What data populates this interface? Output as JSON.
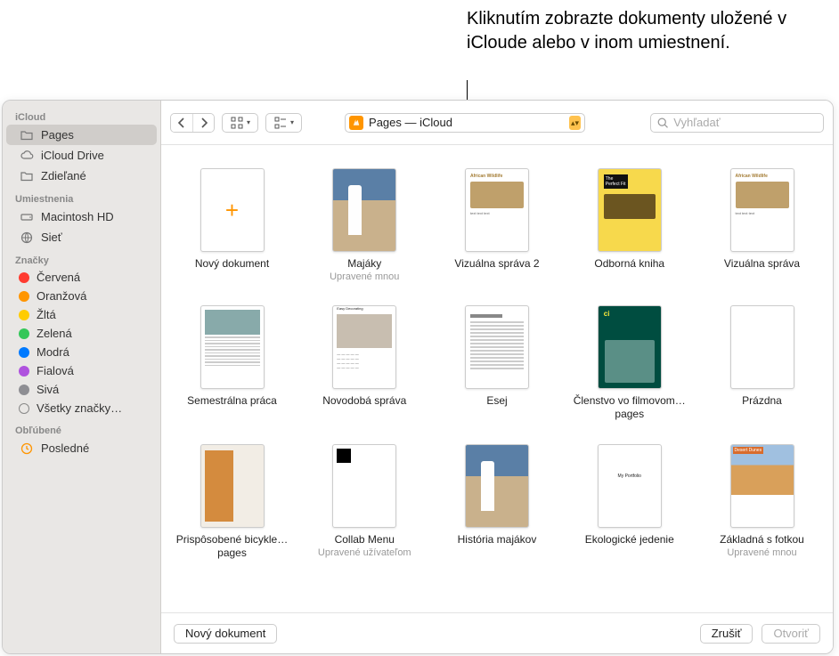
{
  "callout": "Kliknutím zobrazte dokumenty uložené v iCloude alebo v inom umiestnení.",
  "toolbar": {
    "location_label": "Pages — iCloud",
    "search_placeholder": "Vyhľadať"
  },
  "sidebar": {
    "sections": [
      {
        "header": "iCloud",
        "items": [
          {
            "label": "Pages",
            "icon": "folder",
            "selected": true
          },
          {
            "label": "iCloud Drive",
            "icon": "cloud"
          },
          {
            "label": "Zdieľané",
            "icon": "shared-folder"
          }
        ]
      },
      {
        "header": "Umiestnenia",
        "items": [
          {
            "label": "Macintosh HD",
            "icon": "hdd"
          },
          {
            "label": "Sieť",
            "icon": "network"
          }
        ]
      },
      {
        "header": "Značky",
        "items": [
          {
            "label": "Červená",
            "color": "#ff3b30"
          },
          {
            "label": "Oranžová",
            "color": "#ff9500"
          },
          {
            "label": "Žltá",
            "color": "#ffcc00"
          },
          {
            "label": "Zelená",
            "color": "#34c759"
          },
          {
            "label": "Modrá",
            "color": "#007aff"
          },
          {
            "label": "Fialová",
            "color": "#af52de"
          },
          {
            "label": "Sivá",
            "color": "#8e8e93"
          },
          {
            "label": "Všetky značky…",
            "outline": true
          }
        ]
      },
      {
        "header": "Obľúbené",
        "items": [
          {
            "label": "Posledné",
            "icon": "clock"
          }
        ]
      }
    ]
  },
  "documents": [
    [
      {
        "label": "Nový dokument",
        "sub": "",
        "kind": "new"
      },
      {
        "label": "Majáky",
        "sub": "Upravené mnou",
        "kind": "sky"
      },
      {
        "label": "Vizuálna správa 2",
        "sub": "",
        "kind": "wild"
      },
      {
        "label": "Odborná kniha",
        "sub": "",
        "kind": "prof"
      },
      {
        "label": "Vizuálna správa",
        "sub": "",
        "kind": "wild"
      }
    ],
    [
      {
        "label": "Semestrálna práca",
        "sub": "",
        "kind": "sem"
      },
      {
        "label": "Novodobá správa",
        "sub": "",
        "kind": "novo"
      },
      {
        "label": "Esej",
        "sub": "",
        "kind": "essay"
      },
      {
        "label": "Členstvo vo filmovom…pages",
        "sub": "",
        "kind": "cine"
      },
      {
        "label": "Prázdna",
        "sub": "",
        "kind": "blank"
      }
    ],
    [
      {
        "label": "Prispôsobené bicykle…pages",
        "sub": "",
        "kind": "bike"
      },
      {
        "label": "Collab Menu",
        "sub": "Upravené užívateľom",
        "kind": "collab"
      },
      {
        "label": "História majákov",
        "sub": "",
        "kind": "sky"
      },
      {
        "label": "Ekologické jedenie",
        "sub": "",
        "kind": "eco"
      },
      {
        "label": "Základná s fotkou",
        "sub": "Upravené mnou",
        "kind": "dune"
      }
    ]
  ],
  "footer": {
    "new_doc": "Nový dokument",
    "cancel": "Zrušiť",
    "open": "Otvoriť"
  }
}
